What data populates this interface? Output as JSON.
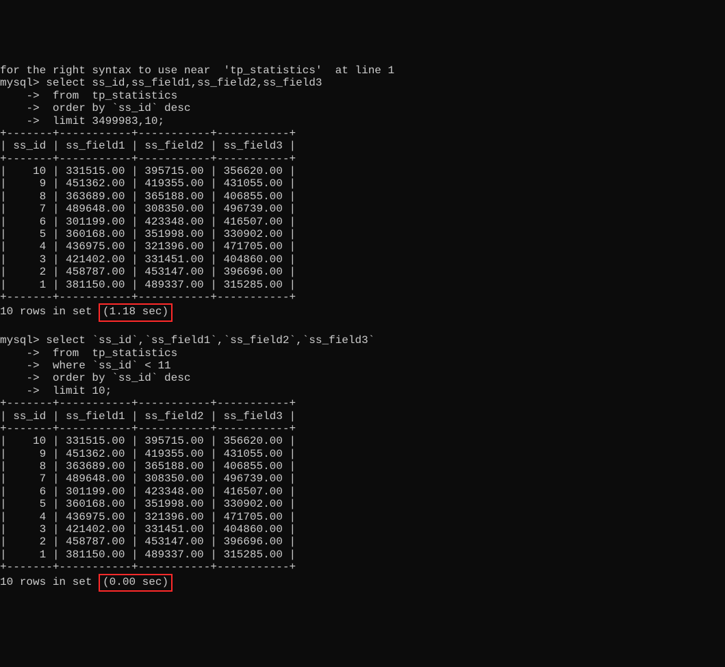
{
  "top_line": "for the right syntax to use near  'tp_statistics'  at line 1",
  "query1": {
    "prompt": "mysql>",
    "cont_prompt": "    ->",
    "lines": [
      "select ss_id,ss_field1,ss_field2,ss_field3",
      "from  tp_statistics",
      "order by `ss_id` desc",
      "limit 3499983,10;"
    ]
  },
  "table1": {
    "border": "+-------+-----------+-----------+-----------+",
    "header": "| ss_id | ss_field1 | ss_field2 | ss_field3 |",
    "rows": [
      "|    10 | 331515.00 | 395715.00 | 356620.00 |",
      "|     9 | 451362.00 | 419355.00 | 431055.00 |",
      "|     8 | 363689.00 | 365188.00 | 406855.00 |",
      "|     7 | 489648.00 | 308350.00 | 496739.00 |",
      "|     6 | 301199.00 | 423348.00 | 416507.00 |",
      "|     5 | 360168.00 | 351998.00 | 330902.00 |",
      "|     4 | 436975.00 | 321396.00 | 471705.00 |",
      "|     3 | 421402.00 | 331451.00 | 404860.00 |",
      "|     2 | 458787.00 | 453147.00 | 396696.00 |",
      "|     1 | 381150.00 | 489337.00 | 315285.00 |"
    ]
  },
  "result1": {
    "prefix": "10 rows in set ",
    "timing": "(1.18 sec)"
  },
  "query2": {
    "prompt": "mysql>",
    "cont_prompt": "    ->",
    "lines": [
      "select `ss_id`,`ss_field1`,`ss_field2`,`ss_field3`",
      "from  tp_statistics",
      "where `ss_id` < 11",
      "order by `ss_id` desc",
      "limit 10;"
    ]
  },
  "table2": {
    "border": "+-------+-----------+-----------+-----------+",
    "header": "| ss_id | ss_field1 | ss_field2 | ss_field3 |",
    "rows": [
      "|    10 | 331515.00 | 395715.00 | 356620.00 |",
      "|     9 | 451362.00 | 419355.00 | 431055.00 |",
      "|     8 | 363689.00 | 365188.00 | 406855.00 |",
      "|     7 | 489648.00 | 308350.00 | 496739.00 |",
      "|     6 | 301199.00 | 423348.00 | 416507.00 |",
      "|     5 | 360168.00 | 351998.00 | 330902.00 |",
      "|     4 | 436975.00 | 321396.00 | 471705.00 |",
      "|     3 | 421402.00 | 331451.00 | 404860.00 |",
      "|     2 | 458787.00 | 453147.00 | 396696.00 |",
      "|     1 | 381150.00 | 489337.00 | 315285.00 |"
    ]
  },
  "result2": {
    "prefix": "10 rows in set ",
    "timing": "(0.00 sec)"
  }
}
